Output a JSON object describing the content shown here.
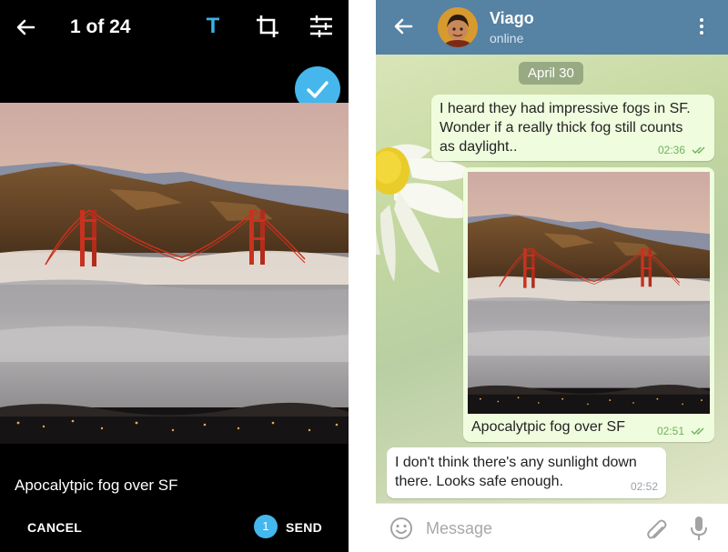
{
  "editor": {
    "counter": "1 of 24",
    "text_tool_label": "T",
    "caption": "Apocalytpic fog over SF",
    "cancel_label": "CANCEL",
    "selected_count": "1",
    "send_label": "SEND",
    "icons": [
      "back-arrow-icon",
      "text-icon",
      "crop-icon",
      "adjust-sliders-icon",
      "check-icon"
    ],
    "accent_color": "#45b7ec"
  },
  "chat": {
    "contact_name": "Viago",
    "contact_status": "online",
    "header_color": "#5682a3",
    "date_label": "April 30",
    "messages": [
      {
        "direction": "outgoing",
        "lines": [
          "I heard they had impressive fogs in SF.",
          "Wonder if a really thick fog still counts",
          "as daylight.."
        ],
        "time": "02:36",
        "read": true
      },
      {
        "direction": "outgoing",
        "type": "photo",
        "caption": "Apocalytpic fog over SF",
        "time": "02:51",
        "read": true
      },
      {
        "direction": "incoming",
        "lines": [
          "I don't think there's any sunlight down",
          "there. Looks safe enough."
        ],
        "time": "02:52"
      }
    ],
    "input": {
      "placeholder": "Message",
      "value": ""
    },
    "icons": [
      "back-arrow-icon",
      "more-vert-icon",
      "emoji-icon",
      "attach-icon",
      "mic-icon"
    ],
    "outgoing_bubble_color": "#effdde",
    "outgoing_time_color": "#6fb15c"
  }
}
